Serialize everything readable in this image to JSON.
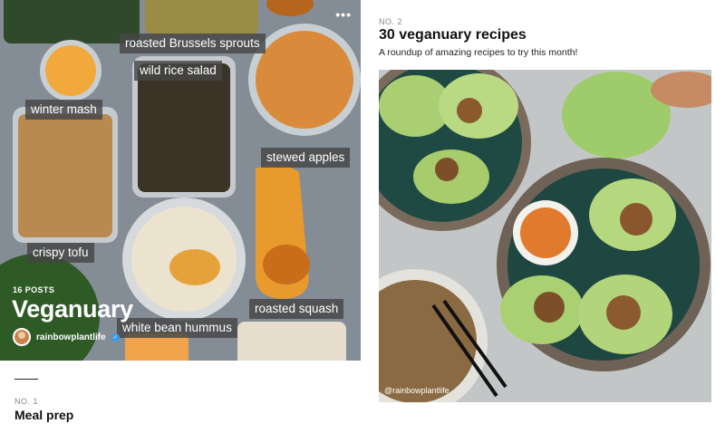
{
  "left_card": {
    "menu_icon": "ellipsis-icon",
    "labels": {
      "brussels": "roasted Brussels sprouts",
      "wild_rice": "wild rice salad",
      "winter_mash": "winter mash",
      "stewed_apples": "stewed apples",
      "crispy_tofu": "crispy tofu",
      "hummus": "white bean hummus",
      "squash": "roasted squash"
    },
    "posts_count": "16 POSTS",
    "title": "Veganuary",
    "author": "rainbowplantlife",
    "verified_icon": "verified-badge-icon",
    "number": "NO. 1",
    "caption_title": "Meal prep"
  },
  "right_card": {
    "number": "NO. 2",
    "title": "30 veganuary recipes",
    "subtitle": "A roundup of amazing recipes to try this month!",
    "photo_credit": "@rainbowplantlife"
  }
}
